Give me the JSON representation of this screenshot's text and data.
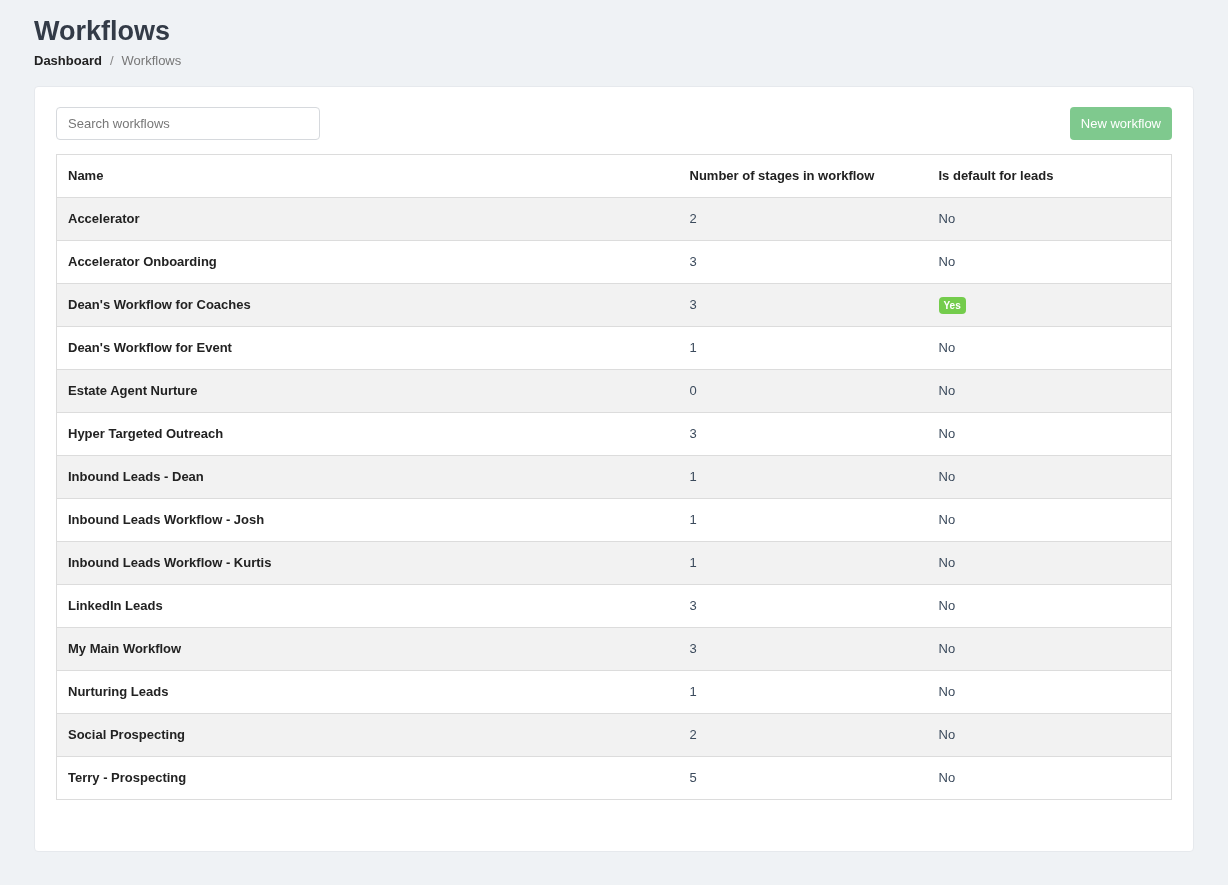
{
  "page": {
    "title": "Workflows"
  },
  "breadcrumb": {
    "items": [
      "Dashboard",
      "Workflows"
    ],
    "separator": "/"
  },
  "search": {
    "placeholder": "Search workflows"
  },
  "new_button": {
    "label": "New workflow",
    "disabled": true
  },
  "table": {
    "columns": [
      "Name",
      "Number of stages in workflow",
      "Is default for leads"
    ],
    "rows": [
      {
        "name": "Accelerator",
        "stages": "2",
        "default_label": "No",
        "is_default": false
      },
      {
        "name": "Accelerator Onboarding",
        "stages": "3",
        "default_label": "No",
        "is_default": false
      },
      {
        "name": "Dean's Workflow for Coaches",
        "stages": "3",
        "default_label": "Yes",
        "is_default": true
      },
      {
        "name": "Dean's Workflow for Event",
        "stages": "1",
        "default_label": "No",
        "is_default": false
      },
      {
        "name": "Estate Agent Nurture",
        "stages": "0",
        "default_label": "No",
        "is_default": false
      },
      {
        "name": "Hyper Targeted Outreach",
        "stages": "3",
        "default_label": "No",
        "is_default": false
      },
      {
        "name": "Inbound Leads - Dean",
        "stages": "1",
        "default_label": "No",
        "is_default": false
      },
      {
        "name": "Inbound Leads Workflow - Josh",
        "stages": "1",
        "default_label": "No",
        "is_default": false
      },
      {
        "name": "Inbound Leads Workflow - Kurtis",
        "stages": "1",
        "default_label": "No",
        "is_default": false
      },
      {
        "name": "LinkedIn Leads",
        "stages": "3",
        "default_label": "No",
        "is_default": false
      },
      {
        "name": "My Main Workflow",
        "stages": "3",
        "default_label": "No",
        "is_default": false
      },
      {
        "name": "Nurturing Leads",
        "stages": "1",
        "default_label": "No",
        "is_default": false
      },
      {
        "name": "Social Prospecting",
        "stages": "2",
        "default_label": "No",
        "is_default": false
      },
      {
        "name": "Terry - Prospecting",
        "stages": "5",
        "default_label": "No",
        "is_default": false
      }
    ]
  }
}
